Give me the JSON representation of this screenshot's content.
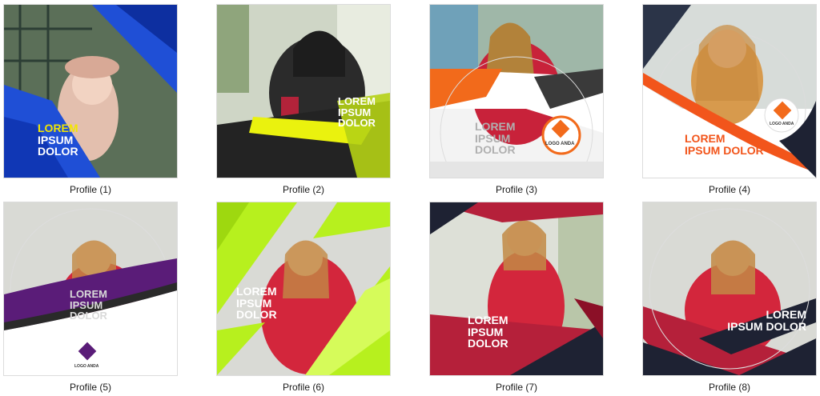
{
  "files": [
    {
      "caption": "Profile (1)",
      "headline": [
        "LOREM",
        "IPSUM",
        "DOLOR"
      ]
    },
    {
      "caption": "Profile (2)",
      "headline": [
        "LOREM",
        "IPSUM",
        "DOLOR"
      ]
    },
    {
      "caption": "Profile (3)",
      "headline": [
        "LOREM",
        "IPSUM",
        "DOLOR"
      ],
      "logo": "LOGO ANDA"
    },
    {
      "caption": "Profile (4)",
      "headline": [
        "LOREM",
        "IPSUM DOLOR"
      ],
      "logo": "LOGO ANDA"
    },
    {
      "caption": "Profile (5)",
      "headline": [
        "LOREM",
        "IPSUM",
        "DOLOR"
      ],
      "logo": "LOGO ANDA"
    },
    {
      "caption": "Profile (6)",
      "headline": [
        "LOREM",
        "IPSUM",
        "DOLOR"
      ]
    },
    {
      "caption": "Profile (7)",
      "headline": [
        "LOREM",
        "IPSUM",
        "DOLOR"
      ]
    },
    {
      "caption": "Profile (8)",
      "headline": [
        "LOREM",
        "IPSUM DOLOR"
      ]
    }
  ],
  "colors": {
    "blue": "#1f4fd6",
    "yellow": "#f2e600",
    "orange": "#f26a1b",
    "purple": "#5a1c78",
    "lime": "#b7f01e",
    "crimson": "#b5203a",
    "navy": "#1e2233"
  }
}
